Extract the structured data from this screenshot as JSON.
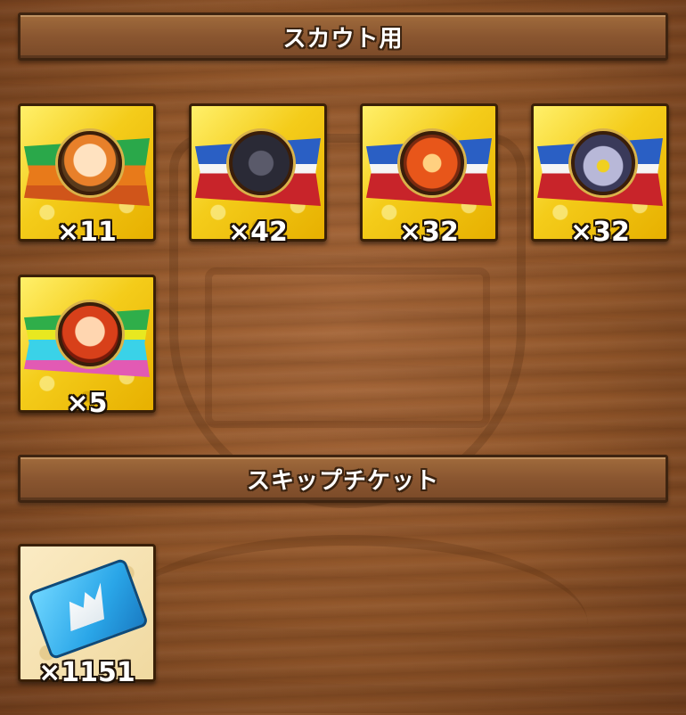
{
  "sections": [
    {
      "title": "スカウト用",
      "items": [
        {
          "count": "×11",
          "icon": "scout-ticket-witch-icon"
        },
        {
          "count": "×42",
          "icon": "scout-ticket-dragon-icon"
        },
        {
          "count": "×32",
          "icon": "scout-ticket-bird-icon"
        },
        {
          "count": "×32",
          "icon": "scout-ticket-monster-icon"
        },
        {
          "count": "×5",
          "icon": "scout-ticket-heroine-icon"
        }
      ]
    },
    {
      "title": "スキップチケット",
      "items": [
        {
          "count": "×1151",
          "icon": "skip-ticket-icon"
        }
      ]
    }
  ]
}
